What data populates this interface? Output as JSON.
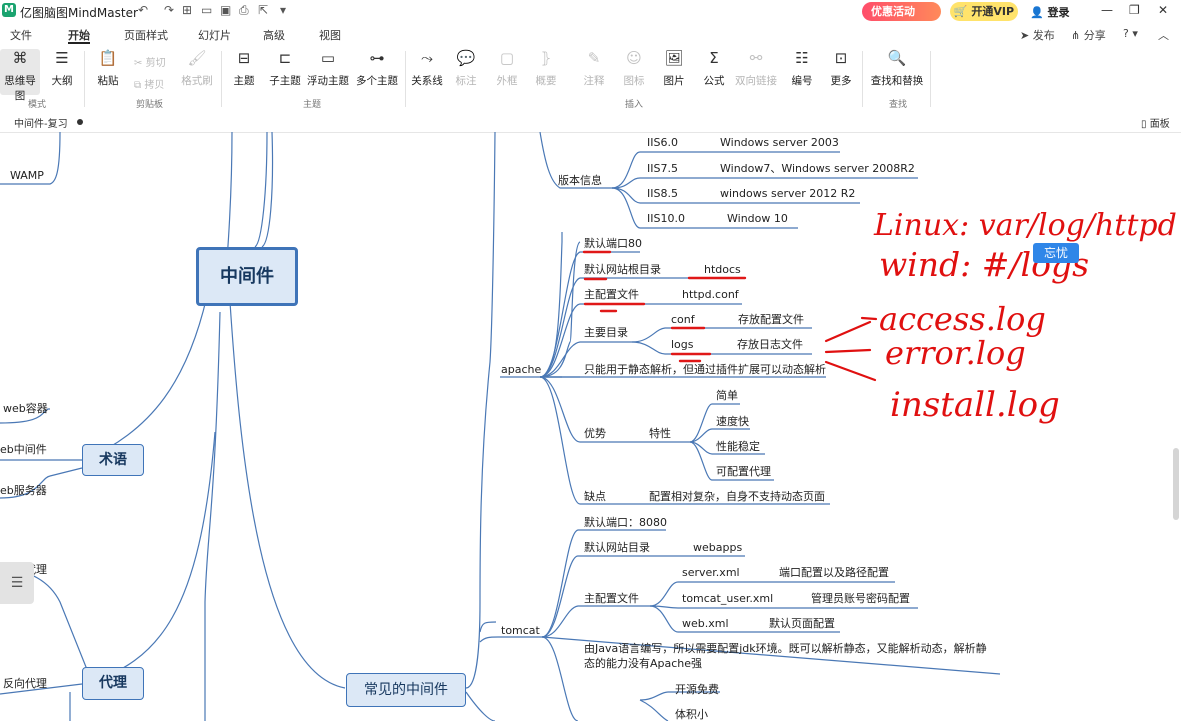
{
  "title_bar": {
    "app_title": "亿图脑图MindMaster",
    "quick_access_icons": [
      "undo-icon",
      "redo-icon",
      "new-icon",
      "open-icon",
      "save-icon",
      "print-icon",
      "export-icon",
      "more-icon"
    ],
    "promo_label": "优惠活动",
    "vip_label": "开通VIP",
    "login_label": "登录"
  },
  "menu": {
    "items": [
      "文件",
      "开始",
      "页面样式",
      "幻灯片",
      "高级",
      "视图"
    ],
    "active": "开始",
    "right": {
      "publish": "发布",
      "share": "分享",
      "help": "?"
    }
  },
  "ribbon": {
    "groups": {
      "mode": "模式",
      "clipboard": "剪贴板",
      "topic": "主题",
      "insert": "插入",
      "find": "查找"
    },
    "buttons": {
      "mindmap": "思维导图",
      "outline": "大纲",
      "paste": "粘贴",
      "cut": "剪切",
      "copy": "拷贝",
      "format_brush": "格式刷",
      "topic": "主题",
      "subtopic": "子主题",
      "float_topic": "浮动主题",
      "multi_topic": "多个主题",
      "relation": "关系线",
      "label": "标注",
      "boundary": "外框",
      "summary": "概要",
      "note": "注释",
      "icon": "图标",
      "image": "图片",
      "formula": "公式",
      "bilink": "双向链接",
      "numbering": "编号",
      "more": "更多",
      "find_replace": "查找和替换"
    }
  },
  "doc_tab": {
    "name": "中间件-复习",
    "panel_label": "面板"
  },
  "mindmap": {
    "central": "中间件",
    "left_items": {
      "wamp": "WAMP",
      "web_container": "web容器",
      "web_middleware": "eb中间件",
      "web_server": "eb服务器",
      "forward_proxy": "正向代理",
      "reverse_proxy": "反向代理"
    },
    "branches": {
      "terms": "术语",
      "proxy": "代理",
      "common": "常见的中间件"
    },
    "iis": {
      "version_info": "版本信息",
      "versions": [
        {
          "name": "IIS6.0",
          "os": "Windows server 2003"
        },
        {
          "name": "IIS7.5",
          "os": "Window7、Windows server 2008R2"
        },
        {
          "name": "IIS8.5",
          "os": "windows server 2012 R2"
        },
        {
          "name": "IIS10.0",
          "os": "Window 10"
        }
      ]
    },
    "apache": {
      "name": "apache",
      "default_port": "默认端口80",
      "web_root": "默认网站根目录",
      "web_root_value": "htdocs",
      "config_file": "主配置文件",
      "config_file_value": "httpd.conf",
      "main_dirs": "主要目录",
      "dir_conf": "conf",
      "dir_conf_desc": "存放配置文件",
      "dir_logs": "logs",
      "dir_logs_desc": "存放日志文件",
      "static_only": "只能用于静态解析，但通过插件扩展可以动态解析",
      "advantage": "优势",
      "features": "特性",
      "feature_items": [
        "简单",
        "速度快",
        "性能稳定",
        "可配置代理"
      ],
      "disadvantage": "缺点",
      "disadvantage_value": "配置相对复杂，自身不支持动态页面"
    },
    "tomcat": {
      "name": "tomcat",
      "default_port": "默认端口：8080",
      "web_dir": "默认网站目录",
      "web_dir_value": "webapps",
      "config_file": "主配置文件",
      "configs": [
        {
          "file": "server.xml",
          "desc": "端口配置以及路径配置"
        },
        {
          "file": "tomcat_user.xml",
          "desc": "管理员账号密码配置"
        },
        {
          "file": "web.xml",
          "desc": "默认页面配置"
        }
      ],
      "java_note_line1": "由Java语言编写，所以需要配置jdk环境。既可以解析静态，又能解析动态，解析静",
      "java_note_line2": "态的能力没有Apache强",
      "open_source": "开源免费",
      "small": "体积小"
    }
  },
  "annotations": {
    "handwriting": [
      "Linux: var/log/httpd",
      "wind: #/logs",
      "access.log",
      "error.log",
      "install.log"
    ],
    "user_tag": "忘忧"
  },
  "colors": {
    "accent": "#3f74b8",
    "branch_line": "#4a78b5",
    "underline": "#e01818",
    "ink": "#e01010",
    "tag": "#2f86e8"
  }
}
